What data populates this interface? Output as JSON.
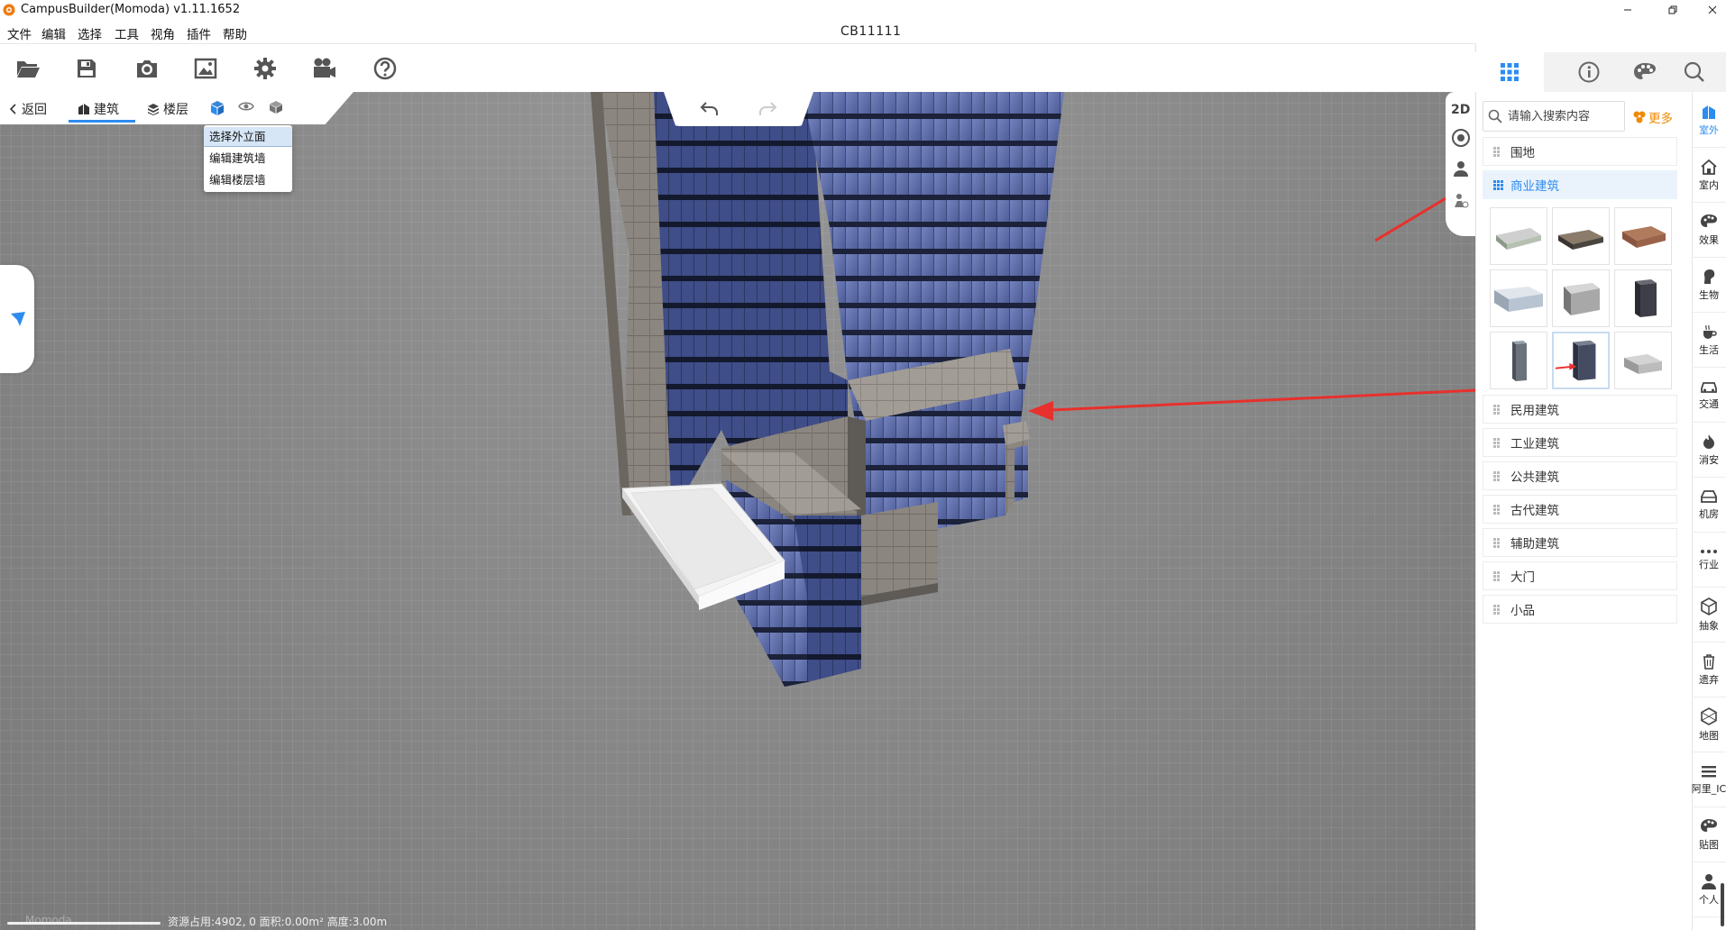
{
  "window": {
    "title": "CampusBuilder(Momoda) v1.11.1652",
    "doc_title": "CB11111"
  },
  "menu": [
    "文件",
    "编辑",
    "选择",
    "工具",
    "视角",
    "插件",
    "帮助"
  ],
  "subtoolbar": {
    "back": "返回",
    "tab_building": "建筑",
    "tab_floor": "楼层"
  },
  "dropdown": [
    "选择外立面",
    "编辑建筑墙",
    "编辑楼层墙"
  ],
  "viewtools": {
    "mode_2d": "2D"
  },
  "status": {
    "hint": "Momoda",
    "text": "资源占用:4902, 0   面积:0.00m²   高度:3.00m"
  },
  "panel": {
    "search_placeholder": "请输入搜索内容",
    "more": "更多",
    "categories": [
      "围地",
      "商业建筑",
      "民用建筑",
      "工业建筑",
      "公共建筑",
      "古代建筑",
      "辅助建筑",
      "大门",
      "小品"
    ],
    "active_category": "商业建筑"
  },
  "rail": [
    "室外",
    "室内",
    "效果",
    "生物",
    "生活",
    "交通",
    "消安",
    "机房",
    "行业",
    "抽象",
    "遗弃",
    "地图",
    "阿里_IC",
    "贴图",
    "个人"
  ],
  "colors": {
    "accent": "#2d8cf0",
    "more": "#f08a00",
    "arrow": "#e8302c"
  }
}
